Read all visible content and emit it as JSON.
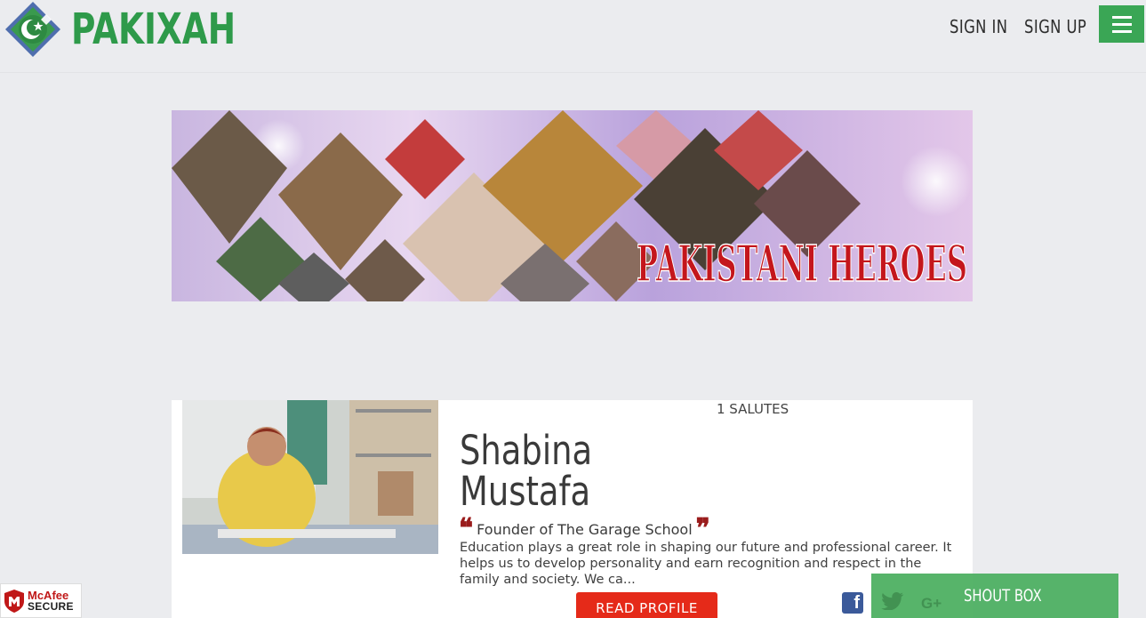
{
  "header": {
    "brand": "PAKIXAH",
    "nav": {
      "signin": "SIGN IN",
      "signup": "SIGN UP"
    }
  },
  "banner": {
    "title": "PAKISTANI HEROES"
  },
  "profile": {
    "salutes": "1 SALUTES",
    "first_name": "Shabina",
    "last_name": "Mustafa",
    "role": "Founder of The Garage School",
    "description": "Education plays a great role in shaping our future and professional career. It helps us to develop personality and earn recognition and respect in the family and society. We ca...",
    "read_button": "READ PROFILE"
  },
  "shoutbox": {
    "label": "SHOUT BOX"
  },
  "badge": {
    "brand": "McAfee",
    "sub": "SECURE"
  },
  "colors": {
    "brand_green": "#2e9a4a",
    "menu_green": "#3aa655",
    "button_red": "#e52a19",
    "quote_red": "#9a1c1c",
    "facebook": "#3b5a9a",
    "shout_green": "#52b266"
  },
  "icons": [
    "hamburger-menu-icon",
    "facebook-icon",
    "twitter-icon",
    "google-plus-icon",
    "mcafee-shield-icon"
  ]
}
